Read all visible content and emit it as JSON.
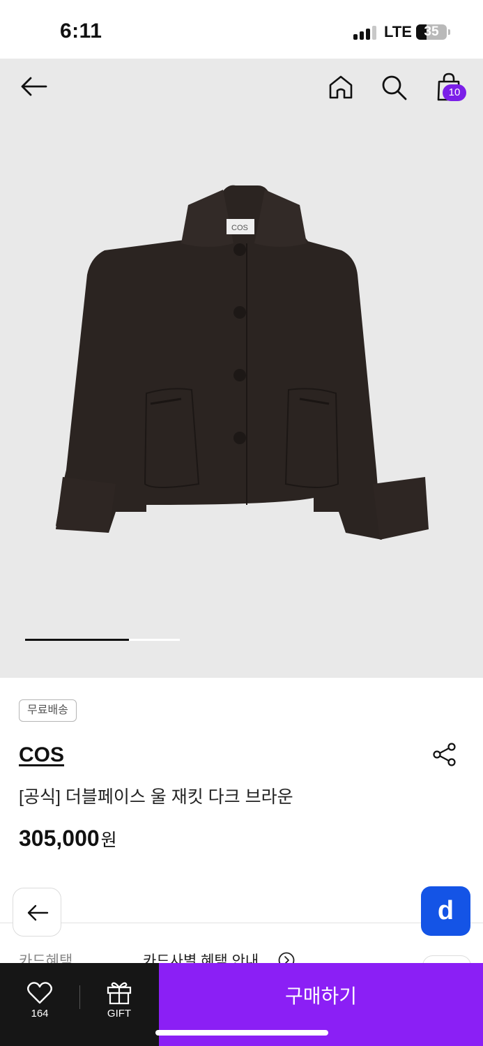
{
  "status_bar": {
    "time": "6:11",
    "network": "LTE",
    "battery_level": 35,
    "battery_label": "35",
    "signal_bars_active": 3,
    "signal_bars_total": 4
  },
  "top_nav": {
    "back_icon": "arrow-left-icon",
    "home_icon": "home-icon",
    "search_icon": "search-icon",
    "cart_icon": "shopping-bag-icon",
    "cart_count": "10",
    "badge_color": "#7b1fe8"
  },
  "gallery": {
    "image": "dark-brown-wool-jacket-product-photo",
    "pager_progress": 0.67
  },
  "product": {
    "badge": "무료배송",
    "brand": "COS",
    "name": "[공식] 더블페이스 울 재킷 다크 브라운",
    "price": "305,000",
    "price_unit": "원",
    "share_icon": "share-icon"
  },
  "card_benefits": {
    "label": "카드혜택",
    "link": "카드사별 혜택 안내",
    "link_icon": "chevron-right-circle-icon"
  },
  "floating": {
    "back_icon": "arrow-left-icon",
    "d_label": "d",
    "d_color": "#1454e6"
  },
  "bottom_bar": {
    "like_icon": "heart-icon",
    "like_count": "164",
    "gift_icon": "gift-icon",
    "gift_label": "GIFT",
    "buy_label": "구매하기",
    "buy_color": "#8b1ff5"
  }
}
